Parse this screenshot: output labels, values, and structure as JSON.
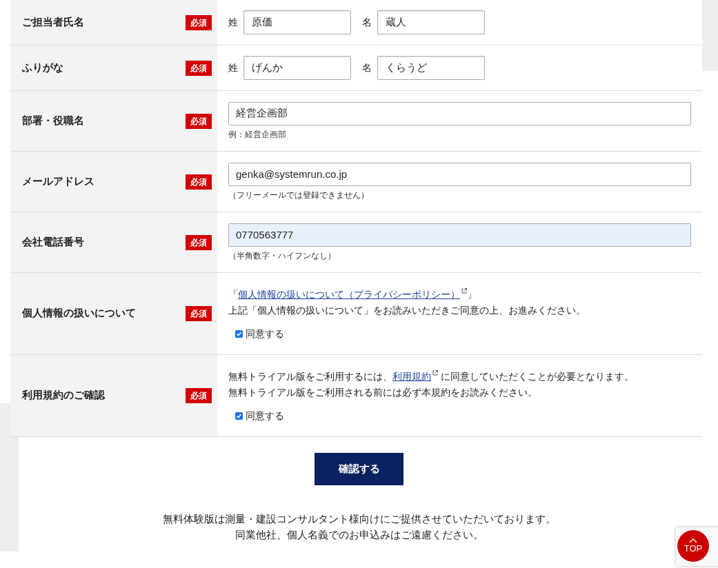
{
  "form": {
    "rows": [
      {
        "kind": "name_pair",
        "label": "ご担当者氏名",
        "badge": "必須",
        "fields": [
          {
            "prefix": "姓",
            "value": "原価"
          },
          {
            "prefix": "名",
            "value": "蔵人"
          }
        ]
      },
      {
        "kind": "name_pair",
        "label": "ふりがな",
        "badge": "必須",
        "fields": [
          {
            "prefix": "姓",
            "value": "げんか"
          },
          {
            "prefix": "名",
            "value": "くらうど"
          }
        ]
      },
      {
        "kind": "text",
        "label": "部署・役職名",
        "badge": "必須",
        "value": "経営企画部",
        "note": "例：経営企画部",
        "highlighted": false
      },
      {
        "kind": "text",
        "label": "メールアドレス",
        "badge": "必須",
        "value": "genka@systemrun.co.jp",
        "note": "（フリーメールでは登録できません）",
        "highlighted": false
      },
      {
        "kind": "text",
        "label": "会社電話番号",
        "badge": "必須",
        "value": "0770563777",
        "note": "（半角数字・ハイフンなし）",
        "highlighted": true
      },
      {
        "kind": "agreement",
        "label": "個人情報の扱いについて",
        "badge": "必須",
        "paragraphs": [
          {
            "before": "「",
            "link": "個人情報の扱いについて（プライバシーポリシー）",
            "after": "」"
          },
          {
            "before": "上記「個人情報の扱いについて」をお読みいただきご同意の上、お進みください。"
          }
        ],
        "checkbox": {
          "label": "同意する",
          "checked": true
        }
      },
      {
        "kind": "agreement",
        "label": "利用規約のご確認",
        "badge": "必須",
        "paragraphs": [
          {
            "before": "無料トライアル版をご利用するには、",
            "link": "利用規約",
            "after": " に同意していただくことが必要となります。"
          },
          {
            "before": "無料トライアル版をご利用される前には必ず本規約をお読みください。"
          }
        ],
        "checkbox": {
          "label": "同意する",
          "checked": true
        }
      }
    ]
  },
  "submit_button": "確認する",
  "footer_notes": [
    "無料体験版は測量・建設コンサルタント様向けにご提供させていただいております。",
    "同業他社、個人名義でのお申込みはご遠慮ください。"
  ],
  "top_button": "TOP"
}
